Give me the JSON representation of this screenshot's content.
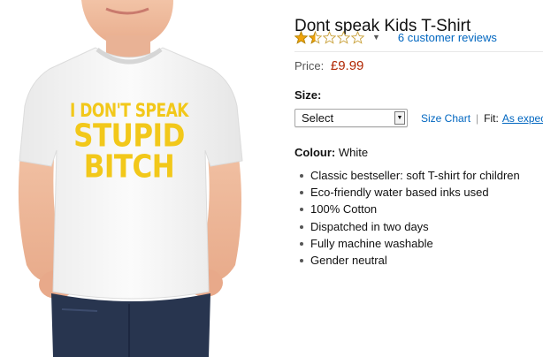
{
  "product": {
    "title": "Dont speak Kids T-Shirt",
    "rating_stars": 1.5,
    "rating_max": 5,
    "reviews_link": "6 customer reviews",
    "price_label": "Price:",
    "price_value": "£9.99",
    "size_label": "Size:",
    "size_select_value": "Select",
    "size_chart_link": "Size Chart",
    "separator": "|",
    "fit_label": "Fit:",
    "fit_value": "As expected",
    "colour_label": "Colour:",
    "colour_value": "White",
    "features": [
      "Classic bestseller: soft T-shirt for children",
      "Eco-friendly water based inks used",
      "100% Cotton",
      "Dispatched in two days",
      "Fully machine washable",
      "Gender neutral"
    ]
  },
  "image": {
    "print_line_1": "I DON'T SPEAK",
    "print_line_2": "STUPID",
    "print_line_3": "BITCH",
    "shirt_color": "#f4f4f4",
    "print_color": "#f2c81a",
    "jeans_color": "#28354f"
  },
  "colors": {
    "link": "#0066c0",
    "price": "#b12704",
    "star_fill": "#f0a30a"
  },
  "icons": {
    "rating": "star-icon",
    "dropdown": "chevron-down-icon",
    "select": "select-arrow-icon"
  }
}
